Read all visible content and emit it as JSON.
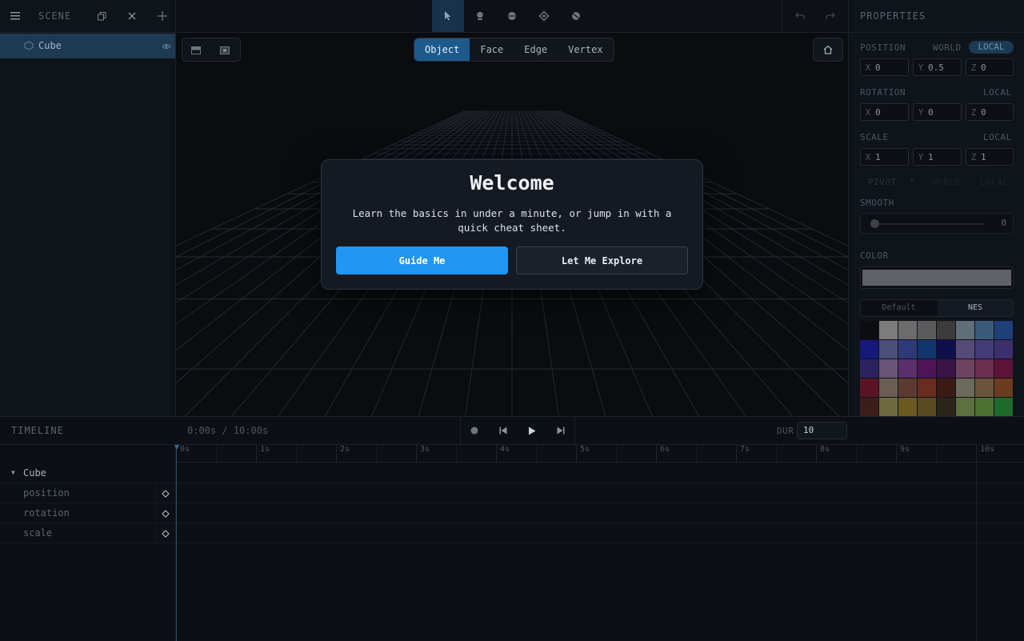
{
  "scene": {
    "title": "SCENE",
    "items": [
      {
        "label": "Cube"
      }
    ]
  },
  "viewport": {
    "modes": [
      "Object",
      "Face",
      "Edge",
      "Vertex"
    ],
    "active_mode": "Object"
  },
  "modal": {
    "title": "Welcome",
    "body": "Learn the basics in under a minute, or jump in with a quick cheat sheet.",
    "primary": "Guide Me",
    "secondary": "Let Me Explore"
  },
  "properties": {
    "title": "PROPERTIES",
    "position": {
      "label": "POSITION",
      "world": "WORLD",
      "local": "LOCAL",
      "x": "0",
      "y": "0.5",
      "z": "0"
    },
    "rotation": {
      "label": "ROTATION",
      "space": "LOCAL",
      "x": "0",
      "y": "0",
      "z": "0"
    },
    "scale": {
      "label": "SCALE",
      "space": "LOCAL",
      "x": "1",
      "y": "1",
      "z": "1"
    },
    "pivot": {
      "label": "PIVOT",
      "dropdown_arrow": "▾",
      "btn1": "WORLD",
      "btn2": "LOCAL"
    },
    "smooth": {
      "label": "SMOOTH",
      "value": "0"
    },
    "color": {
      "label": "COLOR",
      "current": "#5f6268"
    },
    "palette_tabs": [
      "Default",
      "NES"
    ],
    "active_palette": "NES",
    "swatches": [
      "#0c0d10",
      "#7c7c7c",
      "#6c6c6c",
      "#5b5b5b",
      "#3c3c3c",
      "#5f6e78",
      "#3b5a78",
      "#1f3f78",
      "#16187a",
      "#4c4f78",
      "#2e3a78",
      "#12356e",
      "#0f0f4e",
      "#564a78",
      "#433a78",
      "#3c2f6c",
      "#2c2260",
      "#6a5478",
      "#5a2f6a",
      "#4e1456",
      "#3a1445",
      "#6c4460",
      "#6c2e4e",
      "#5c1438",
      "#5a1426",
      "#6a5e54",
      "#5c3a30",
      "#6a2c1e",
      "#3a1a14",
      "#6c6a5a",
      "#6a543c",
      "#6c3c20",
      "#3c1e18",
      "#6e6a40",
      "#6a5a22",
      "#5a4a20",
      "#2a261c",
      "#5e7040",
      "#4c7030",
      "#1e6a2c"
    ]
  },
  "timeline": {
    "title": "TIMELINE",
    "time": "0:00s / 10:00s",
    "dur_label": "DUR",
    "dur_value": "10",
    "ticks": [
      "0s",
      "1s",
      "2s",
      "3s",
      "4s",
      "5s",
      "6s",
      "7s",
      "8s",
      "9s",
      "10s"
    ],
    "object": "Cube",
    "tracks": [
      "position",
      "rotation",
      "scale"
    ]
  }
}
